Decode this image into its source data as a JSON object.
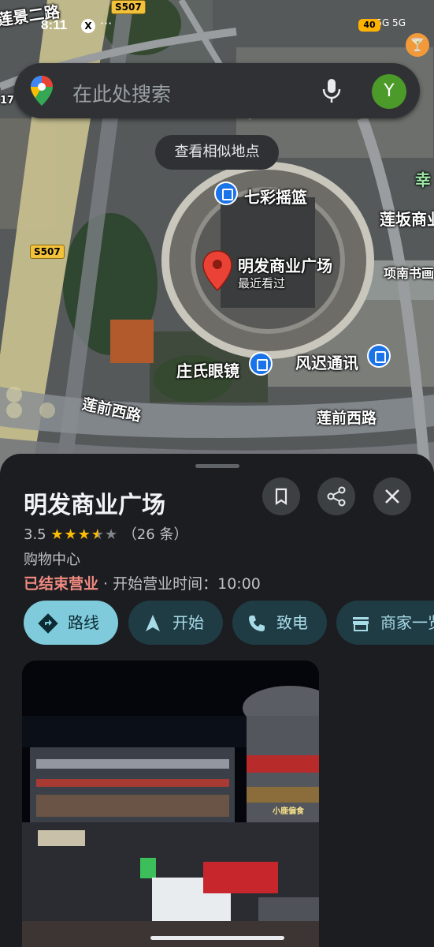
{
  "status_bar": {
    "time": "8:11",
    "x_badge": "X",
    "dots": "···",
    "signal": "5G 5G",
    "battery": "40"
  },
  "search": {
    "placeholder": "在此处搜索",
    "avatar_letter": "Y"
  },
  "map": {
    "similar_places_label": "查看相似地点",
    "labels": {
      "street_top": "莲景二路",
      "road_sign_top": "S507",
      "road_sign_left": "S507",
      "poi_qicai": "七彩摇篮",
      "poi_lianban": "莲坂商业",
      "place_name": "明发商业广场",
      "place_sub": "最近看过",
      "poi_xiangnan": "项南书画",
      "poi_zhuangshi": "庄氏眼镜",
      "poi_fengchi": "风迟通讯",
      "road_lianqian_left": "莲前西路",
      "road_lianqian_right": "莲前西路",
      "edge_text": "幸",
      "left_edge_num": "17"
    }
  },
  "place": {
    "title": "明发商业广场",
    "rating": "3.5",
    "review_count": "（26 条）",
    "category": "购物中心",
    "status": "已结束营业",
    "opening": " · 开始营业时间：10:00",
    "actions": [
      {
        "label": "路线",
        "icon": "directions-icon"
      },
      {
        "label": "开始",
        "icon": "navigation-icon"
      },
      {
        "label": "致电",
        "icon": "phone-icon"
      },
      {
        "label": "商家一览",
        "icon": "store-icon"
      }
    ],
    "photo_signs": {
      "shop_sign": "小鹿偏食"
    }
  },
  "colors": {
    "accent_chip": "#7fcbdc",
    "closed_red": "#f28b82",
    "star": "#fbbc04",
    "pin_red": "#ea4335"
  }
}
